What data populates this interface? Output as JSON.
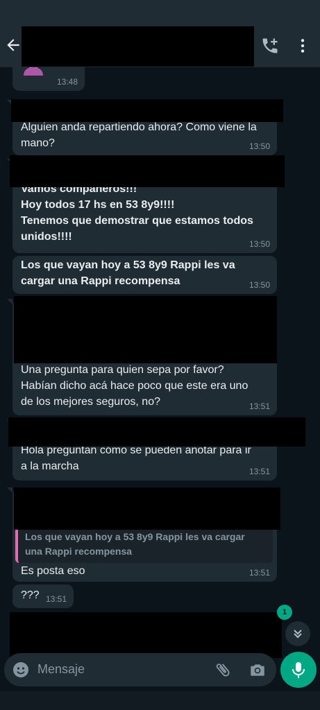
{
  "header": {
    "back_icon": "arrow-left-icon",
    "call_icon": "add-call-icon",
    "menu_icon": "more-vertical-icon"
  },
  "messages": [
    {
      "id": "m0",
      "time": "13:48",
      "content": "emoji-sticker"
    },
    {
      "id": "m1",
      "text": "Alguien anda repartiendo ahora? Como viene la\nmano?",
      "time": "13:50"
    },
    {
      "id": "m2",
      "text": "Vamos compañeros!!!\nHoy todos 17 hs en 53 8y9!!!!\nTenemos que demostrar que estamos todos\nunidos!!!!",
      "time": "13:50"
    },
    {
      "id": "m3",
      "text": "Los que vayan hoy a 53 8y9 Rappi les va\ncargar una Rappi recompensa",
      "time": "13:50"
    },
    {
      "id": "m4",
      "text": "Una pregunta para quien sepa por favor?\nHabían dicho acá hace poco que este era uno\nde los mejores seguros, no?",
      "time": "13:51"
    },
    {
      "id": "m5",
      "text": "Hola preguntan cómo se pueden anotar para ir\na la marcha",
      "time": "13:51"
    },
    {
      "id": "m6",
      "quote": "Los que vayan hoy a 53 8y9 Rappi les va cargar\nuna Rappi recompensa",
      "text": "Es posta eso",
      "time": "13:51"
    },
    {
      "id": "m7",
      "text": "???",
      "time": "13:51"
    }
  ],
  "unread_count": "1",
  "composer": {
    "placeholder": "Mensaje",
    "emoji_icon": "emoji-icon",
    "attach_icon": "paperclip-icon",
    "camera_icon": "camera-icon",
    "mic_icon": "microphone-icon"
  },
  "colors": {
    "background": "#0b141a",
    "bubble": "#202c33",
    "header": "#1f2c34",
    "accent": "#00a884",
    "quote_bar": "#e26ab6"
  }
}
